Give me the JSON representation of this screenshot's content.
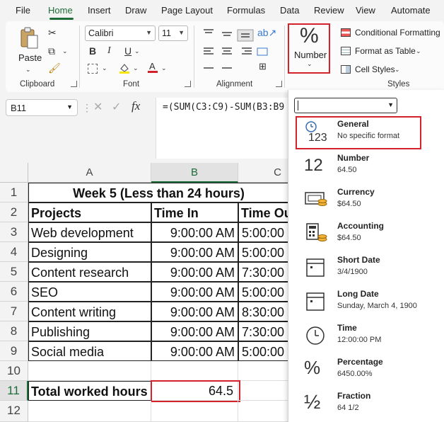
{
  "menu": {
    "tabs": [
      "File",
      "Home",
      "Insert",
      "Draw",
      "Page Layout",
      "Formulas",
      "Data",
      "Review",
      "View",
      "Automate"
    ],
    "active": "Home"
  },
  "ribbon": {
    "clipboard": {
      "paste_label": "Paste",
      "group_label": "Clipboard"
    },
    "font": {
      "font_name": "Calibri",
      "font_size": "11",
      "group_label": "Font",
      "bold": "B",
      "italic": "I",
      "underline": "U"
    },
    "alignment": {
      "group_label": "Alignment"
    },
    "number": {
      "label": "Number",
      "icon": "%"
    },
    "styles": {
      "conditional": "Conditional Formatting",
      "format_table": "Format as Table",
      "cell_styles": "Cell Styles",
      "group_label": "Styles"
    }
  },
  "formula_bar": {
    "name_box": "B11",
    "fx": "fx",
    "formula": "=(SUM(C3:C9)-SUM(B3:B9"
  },
  "sheet": {
    "columns": [
      "A",
      "B",
      "C"
    ],
    "rows": [
      "1",
      "2",
      "3",
      "4",
      "5",
      "6",
      "7",
      "8",
      "9",
      "10",
      "11",
      "12"
    ],
    "title": "Week 5 (Less than 24 hours)",
    "headers": [
      "Projects",
      "Time In",
      "Time Out"
    ],
    "data": [
      [
        "Web development",
        "9:00:00 AM",
        "5:00:00"
      ],
      [
        "Designing",
        "9:00:00 AM",
        "5:00:00"
      ],
      [
        "Content research",
        "9:00:00 AM",
        "7:30:00"
      ],
      [
        "SEO",
        "9:00:00 AM",
        "5:00:00"
      ],
      [
        "Content writing",
        "9:00:00 AM",
        "8:30:00"
      ],
      [
        "Publishing",
        "9:00:00 AM",
        "7:30:00"
      ],
      [
        "Social media",
        "9:00:00 AM",
        "5:00:00"
      ]
    ],
    "total_label": "Total worked hours",
    "total_value": "64.5"
  },
  "format_dropdown": {
    "items": [
      {
        "title": "General",
        "sub": "No specific format",
        "icon": "clock-123-icon"
      },
      {
        "title": "Number",
        "sub": "64.50",
        "icon": "12-icon"
      },
      {
        "title": "Currency",
        "sub": "$64.50",
        "icon": "currency-icon"
      },
      {
        "title": "Accounting",
        "sub": " $64.50",
        "icon": "accounting-icon"
      },
      {
        "title": "Short Date",
        "sub": "3/4/1900",
        "icon": "calendar-icon"
      },
      {
        "title": "Long Date",
        "sub": "Sunday, March 4, 1900",
        "icon": "calendar-icon"
      },
      {
        "title": "Time",
        "sub": "12:00:00 PM",
        "icon": "clock-icon"
      },
      {
        "title": "Percentage",
        "sub": "6450.00%",
        "icon": "percent-icon"
      },
      {
        "title": "Fraction",
        "sub": "64 1/2",
        "icon": "fraction-icon"
      }
    ],
    "glyphs": {
      "n123": "123",
      "n12": "12",
      "pct": "%",
      "half": "½"
    }
  },
  "colors": {
    "accent": "#1e6b3a",
    "highlight": "#d3222a"
  }
}
